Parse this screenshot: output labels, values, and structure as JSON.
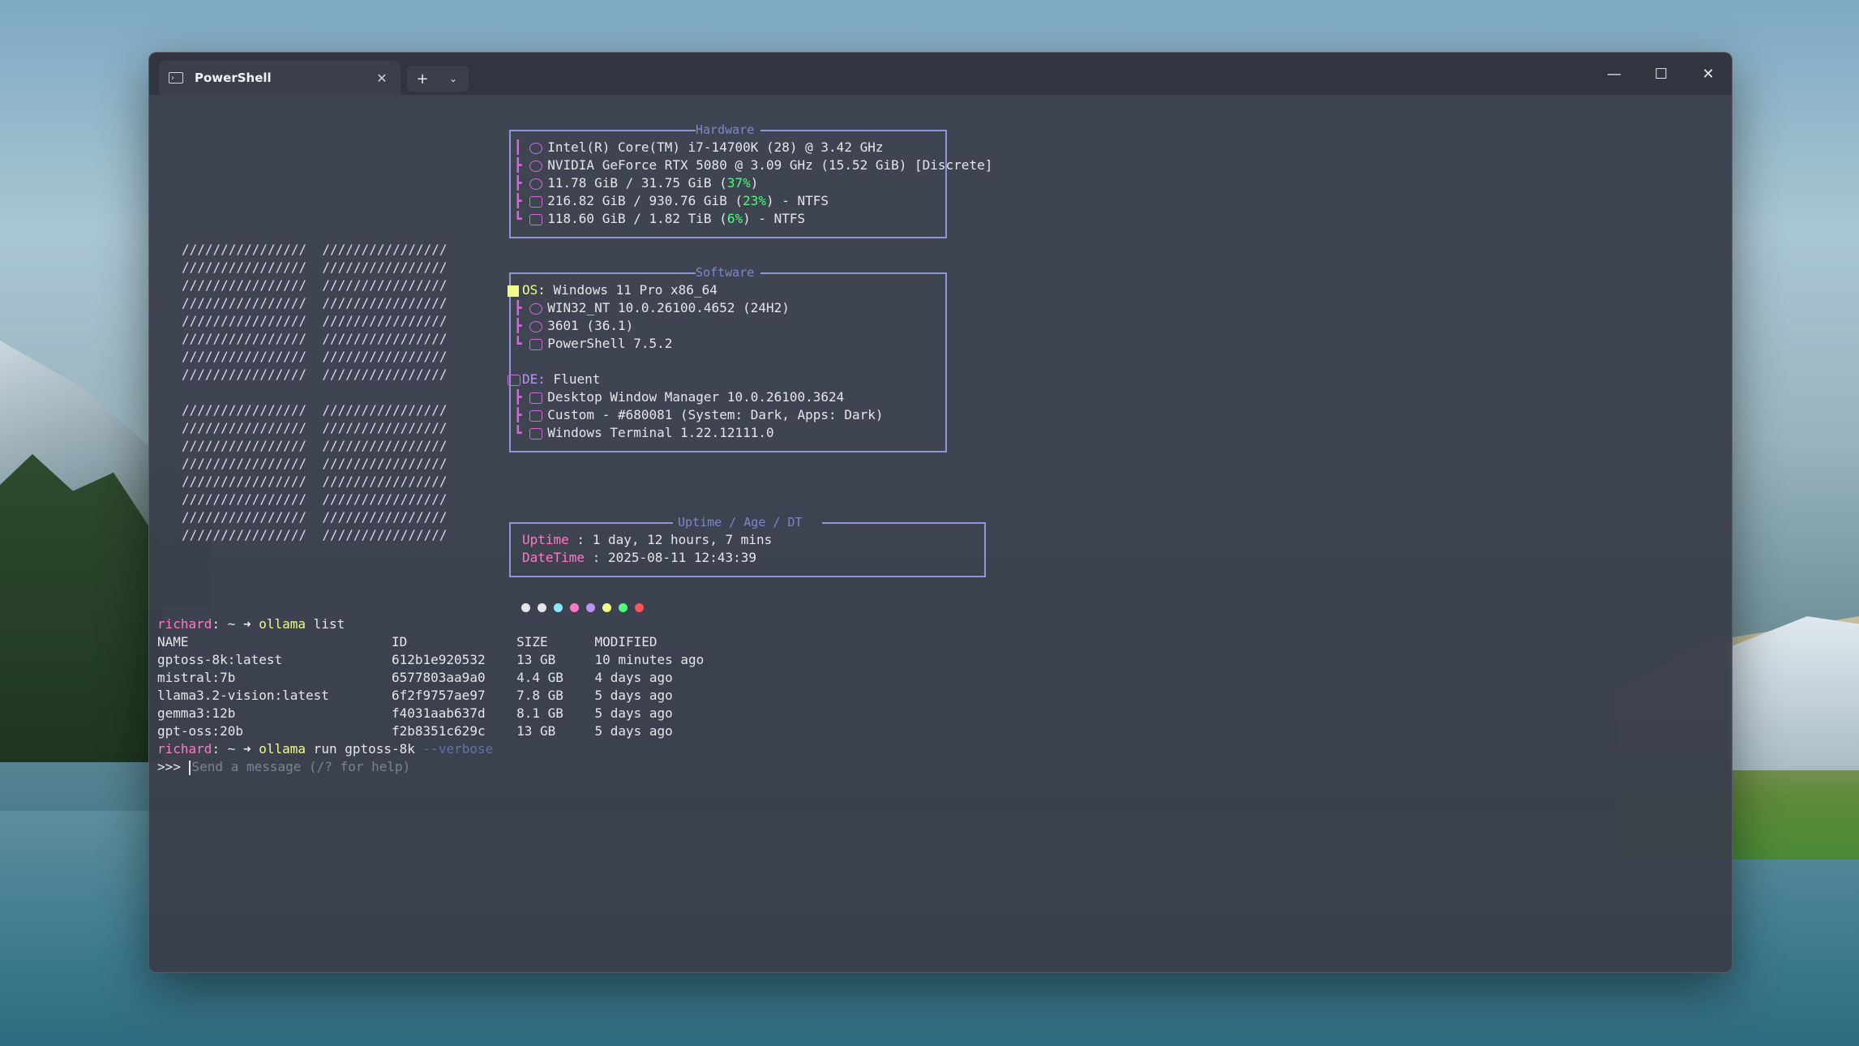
{
  "window": {
    "tab_title": "PowerShell",
    "tab_icon": "powershell-icon",
    "new_tab": "+",
    "dropdown": "⌄",
    "minimize": "—",
    "maximize": "☐",
    "close": "✕"
  },
  "ascii_logo": [
    "////////////////  ////////////////",
    "////////////////  ////////////////",
    "////////////////  ////////////////",
    "////////////////  ////////////////",
    "////////////////  ////////////////",
    "////////////////  ////////////////",
    "////////////////  ////////////////",
    "////////////////  ////////////////",
    "",
    "////////////////  ////////////////",
    "////////////////  ////////////////",
    "////////////////  ////////////////",
    "////////////////  ////////////////",
    "////////////////  ////////////////",
    "////////////////  ////////////////",
    "////////////////  ////////////////",
    "////////////////  ////////////////"
  ],
  "hardware": {
    "title": "Hardware",
    "cpu": "Intel(R) Core(TM) i7-14700K (28) @ 3.42 GHz",
    "gpu": "NVIDIA GeForce RTX 5080 @ 3.09 GHz (15.52 GiB) [Discrete]",
    "memory_pre": "11.78 GiB / 31.75 GiB (",
    "memory_pct": "37%",
    "memory_post": ")",
    "disk1_pre": "216.82 GiB / 930.76 GiB (",
    "disk1_pct": "23%",
    "disk1_post": ") - NTFS",
    "disk2_pre": "118.60 GiB / 1.82 TiB (",
    "disk2_pct": "6%",
    "disk2_post": ") - NTFS"
  },
  "software": {
    "title": "Software",
    "os_key": "OS:",
    "os_value": "Windows 11 Pro x86_64",
    "kernel": "WIN32_NT 10.0.26100.4652 (24H2)",
    "packages": "3601 (36.1)",
    "shell": "PowerShell 7.5.2",
    "de_key": "DE:",
    "de_value": "Fluent",
    "wm": "Desktop Window Manager 10.0.26100.3624",
    "theme": "Custom - #680081 (System: Dark, Apps: Dark)",
    "terminal": "Windows Terminal 1.22.12111.0"
  },
  "uptime_box": {
    "title": "Uptime / Age / DT",
    "uptime_key": "Uptime",
    "uptime_value": " : 1 day, 12 hours, 7 mins",
    "datetime_key": "DateTime",
    "datetime_value": " : 2025-08-11 12:43:39"
  },
  "color_dots": [
    "#e4e6ea",
    "#e4e6ea",
    "#8be9fd",
    "#ff79c6",
    "#bd93f9",
    "#f1fa8c",
    "#50fa7b",
    "#ff5555"
  ],
  "session": {
    "prompt_user": "richard",
    "prompt_rest": ": ~ ",
    "arrow": "➜",
    "cmd1_name": "ollama",
    "cmd1_args": " list",
    "table_header": "NAME                          ID              SIZE      MODIFIED",
    "rows": [
      "gptoss-8k:latest              612b1e920532    13 GB     10 minutes ago",
      "mistral:7b                    6577803aa9a0    4.4 GB    4 days ago",
      "llama3.2-vision:latest        6f2f9757ae97    7.8 GB    5 days ago",
      "gemma3:12b                    f4031aab637d    8.1 GB    5 days ago",
      "gpt-oss:20b                   f2b8351c629c    13 GB     5 days ago"
    ],
    "cmd2_name": "ollama",
    "cmd2_args": " run gptoss-8k ",
    "cmd2_flag": "--verbose",
    "input_prompt": ">>> ",
    "input_placeholder": "Send a message (/? for help)"
  }
}
